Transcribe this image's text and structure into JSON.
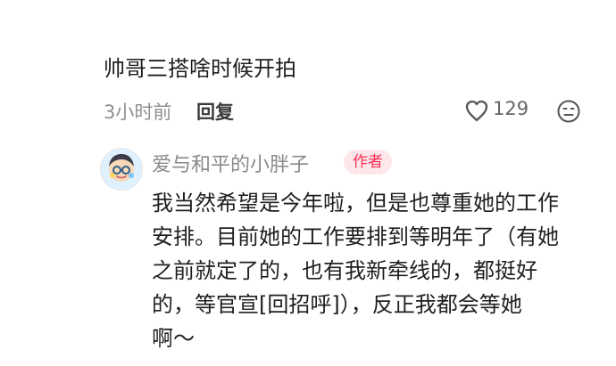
{
  "comment": {
    "text": "帅哥三搭啥时候开拍",
    "time": "3小时前",
    "reply_label": "回复",
    "like_count": "129",
    "like_icon": "heart-outline-icon",
    "emoji_icon": "face-emoji-icon"
  },
  "reply": {
    "username": "爱与和平的小胖子",
    "badge": "作者",
    "lines": [
      "我当然希望是今年啦，但是也尊重她的工作",
      "安排。目前她的工作要排到等明年了（有她",
      "之前就定了的，也有我新牵线的，都挺好",
      "的，等官宣[回招呼]），反正我都会等她",
      "啊～"
    ]
  },
  "colors": {
    "badge_text": "#ff2d55",
    "badge_bg": "#fde7ea",
    "muted_text": "#8f8f8f"
  }
}
